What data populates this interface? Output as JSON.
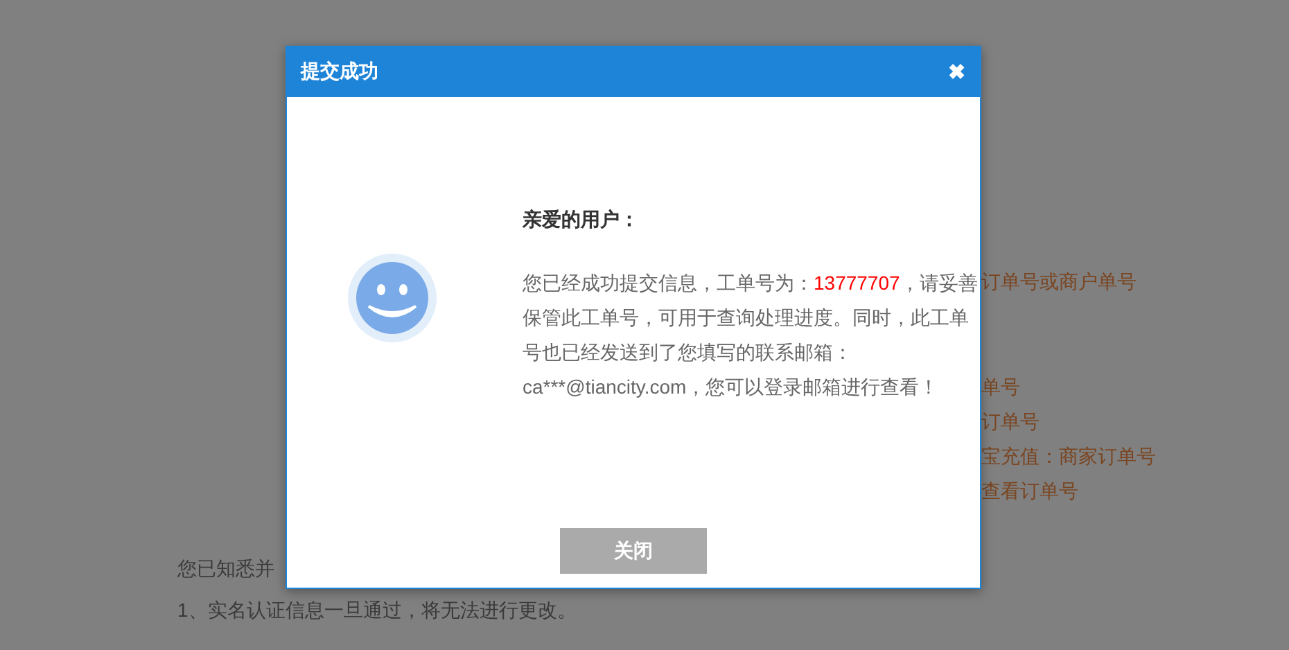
{
  "page": {
    "order_hints": [
      "订单号或商户单号",
      "单号",
      "订单号",
      "宝充值：商家订单号",
      "查看订单号"
    ],
    "notice_title": "您已知悉并",
    "notice_items": [
      "1、实名认证信息一旦通过，将无法进行更改。"
    ]
  },
  "dialog": {
    "title": "提交成功",
    "close_icon": "✖",
    "greeting": "亲爱的用户：",
    "message": {
      "before": "您已经成功提交信息，工单号为：",
      "ticket_number": "13777707",
      "after": "，请妥善保管此工单号，可用于查询处理进度。同时，此工单号也已经发送到了您填写的联系邮箱：",
      "email_note": "ca***@tiancity.com，您可以登录邮箱进行查看！"
    },
    "button": "关闭"
  }
}
